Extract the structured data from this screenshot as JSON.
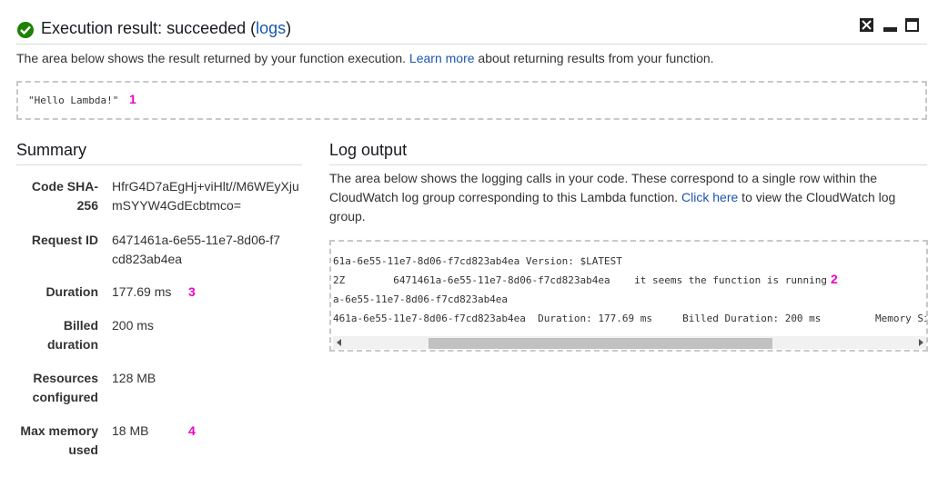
{
  "header": {
    "title_prefix": "Execution result: succeeded (",
    "logs_link": "logs",
    "title_suffix": ")"
  },
  "intro": {
    "before": "The area below shows the result returned by your function execution. ",
    "link": "Learn more",
    "after": " about returning results from your function."
  },
  "result": {
    "text": "\"Hello Lambda!\"",
    "marker": "1"
  },
  "summary": {
    "title": "Summary",
    "rows": [
      {
        "label": "Code SHA-256",
        "value": "HfrG4D7aEgHj+viHlt//M6WEyXjumSYYW4GdEcbtmco=",
        "marker": ""
      },
      {
        "label": "Request ID",
        "value": "6471461a-6e55-11e7-8d06-f7cd823ab4ea",
        "marker": ""
      },
      {
        "label": "Duration",
        "value": "177.69 ms",
        "marker": "3"
      },
      {
        "label": "Billed duration",
        "value": "200 ms",
        "marker": ""
      },
      {
        "label": "Resources configured",
        "value": "128 MB",
        "marker": ""
      },
      {
        "label": "Max memory used",
        "value": "18 MB",
        "marker": "4"
      }
    ]
  },
  "log": {
    "title": "Log output",
    "desc_before": "The area below shows the logging calls in your code. These correspond to a single row within the CloudWatch log group corresponding to this Lambda function. ",
    "desc_link": "Click here",
    "desc_after": " to view the CloudWatch log group.",
    "lines": [
      "61a-6e55-11e7-8d06-f7cd823ab4ea Version: $LATEST",
      "2Z        6471461a-6e55-11e7-8d06-f7cd823ab4ea    it seems the function is running",
      "a-6e55-11e7-8d06-f7cd823ab4ea",
      "461a-6e55-11e7-8d06-f7cd823ab4ea  Duration: 177.69 ms     Billed Duration: 200 ms         Memory Si"
    ],
    "marker": "2"
  },
  "colors": {
    "success": "#1d8102",
    "link": "#1a56b0",
    "marker": "#ee00cc"
  },
  "icons": [
    "check-circle-icon",
    "close-icon",
    "minimize-icon",
    "maximize-icon"
  ]
}
